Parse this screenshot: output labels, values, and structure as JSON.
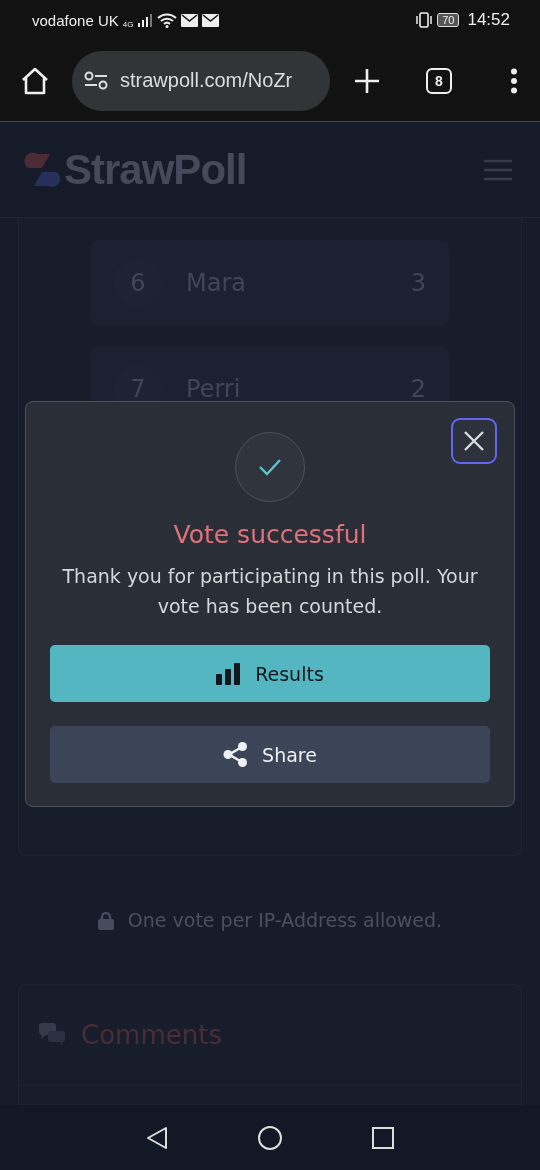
{
  "status_bar": {
    "carrier": "vodafone UK",
    "network": "4G",
    "battery": "70",
    "time": "14:52"
  },
  "browser": {
    "url": "strawpoll.com/NoZr",
    "tab_count": "8"
  },
  "site_header": {
    "logo": "StrawPoll"
  },
  "results": [
    {
      "rank": "6",
      "name": "Mara",
      "votes": "3"
    },
    {
      "rank": "7",
      "name": "Perri",
      "votes": "2"
    }
  ],
  "note": "One vote per IP-Address allowed.",
  "comments": {
    "title": "Comments"
  },
  "modal": {
    "title": "Vote successful",
    "message": "Thank you for participating in this poll. Your vote has been counted.",
    "buttons": [
      {
        "label": "Results",
        "kind": "primary"
      },
      {
        "label": "Share",
        "kind": "secondary"
      }
    ]
  }
}
